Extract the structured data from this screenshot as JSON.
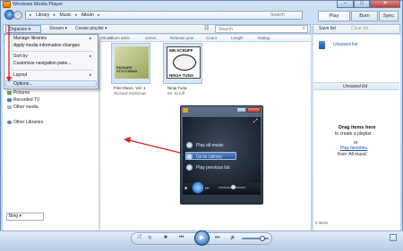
{
  "window": {
    "title": "Windows Media Player",
    "minimize": "–",
    "maximize": "□",
    "close": "✕"
  },
  "address": {
    "crumbs": [
      "Library",
      "Music",
      "Album"
    ],
    "search_placeholder": "Search"
  },
  "tabs": [
    "Play",
    "Burn",
    "Sync"
  ],
  "toolbar": {
    "organize": "Organize ▾",
    "stream": "Stream ▾",
    "create_playlist": "Create playlist ▾",
    "search_placeholder": "Search",
    "save_list": "Save list",
    "clear_list": "Clear list"
  },
  "columns": [
    "Album",
    "Album artist",
    "Genre",
    "Release year",
    "Count",
    "Length",
    "Rating"
  ],
  "organize_menu": {
    "items": [
      {
        "label": "Manage libraries",
        "submenu": true
      },
      {
        "label": "Apply media information changes",
        "submenu": false
      },
      {
        "label": "Sort by",
        "submenu": true
      },
      {
        "label": "Customize navigation pane...",
        "submenu": false
      },
      {
        "label": "Layout",
        "submenu": true
      },
      {
        "label": "Options...",
        "submenu": false
      }
    ]
  },
  "nav": {
    "items": [
      {
        "label": "Pictures",
        "color": "#6aa84f"
      },
      {
        "label": "Recorded TV",
        "color": "#3d85c6"
      },
      {
        "label": "Other media",
        "color": "#9fb8d6"
      }
    ],
    "other_libraries": "Other Libraries",
    "search_provider": "Bing ▾"
  },
  "albums": [
    {
      "title": "Fine Music, Vol. 1",
      "artist": "Richard Stoltzman",
      "cover_text": "RICHARD STOLTZMAN"
    },
    {
      "title": "Ninja Tuna",
      "artist": "Mr. Scruff",
      "cover_top": "MR.SCRUFF",
      "cover_bottom": "NINJA TUNA"
    }
  ],
  "mini_player": {
    "items": [
      "Play all music",
      "Go to Library",
      "Play previous list"
    ]
  },
  "list_pane": {
    "unsaved_title": "Unsaved list",
    "header": "Unsaved list",
    "drag_title": "Drag items here",
    "drag_sub": "to create a playlist",
    "or": "or",
    "play_favorites": "Play favorites",
    "from": "from 'All music'.",
    "count": "0 items"
  },
  "transport": {
    "shuffle": "⤮",
    "repeat": "↻",
    "stop": "■",
    "prev": "⏮",
    "play": "▶",
    "next": "⏭",
    "mute": "🔊"
  }
}
